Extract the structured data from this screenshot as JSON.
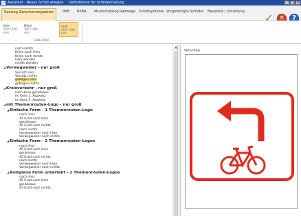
{
  "titlebar": {
    "app": "Assistent · Neues Schild anlegen",
    "subtitle": "Definitionen für Schilderstellung",
    "buttons": [
      "_",
      "□",
      "X"
    ]
  },
  "tabs": [
    {
      "label": "Radweg-Zwischenwegweiser",
      "active": true
    },
    {
      "label": "RhB"
    },
    {
      "label": "RhBA"
    },
    {
      "label": "Musterkatalog"
    },
    {
      "label": "Radwege"
    },
    {
      "label": "Schildsymbole"
    },
    {
      "label": "Vorgefertigte Schilder"
    },
    {
      "label": "Baustelle / Umleitung"
    }
  ],
  "actions": {
    "ok": "✓",
    "cancel": "✕",
    "help": "?"
  },
  "ribbon": {
    "sizes": [
      {
        "label": "Klein",
        "dims": "250 * 250 mm"
      },
      {
        "label": "Mittel",
        "dims": "300 * 300 mm"
      },
      {
        "label": "Groß",
        "dims": "350 * 350 mm",
        "selected": true
      }
    ],
    "group_label": "Größe Tafel"
  },
  "preview": {
    "label": "Vorschau"
  },
  "colors": {
    "sign_red": "#e02a1c",
    "highlight": "#f7dc62",
    "titlebar": "#1e4fa0",
    "ribbon_selected": "#fbdc96"
  },
  "tree": [
    {
      "text": "nach rechts",
      "level": 2
    },
    {
      "text": "Knick nach links",
      "level": 2
    },
    {
      "text": "Knick nach rechts",
      "level": 2
    },
    {
      "text": "links wenden",
      "level": 2
    },
    {
      "text": "rechts wenden",
      "level": 2
    },
    {
      "text": "Vorwegweiser - nur groß",
      "level": 0,
      "heading": true
    },
    {
      "text": "Versatz links",
      "level": 2
    },
    {
      "text": "Versatz rechts",
      "level": 2
    },
    {
      "text": "gebogen links",
      "level": 2,
      "highlight": true
    },
    {
      "text": "gebogen rechts",
      "level": 2
    },
    {
      "text": "Kreisverkehr - nur groß",
      "level": 0,
      "heading": true
    },
    {
      "text": "nach Kreis geradeaus",
      "level": 2
    },
    {
      "text": "im Kreis 1. Abzweig",
      "level": 2
    },
    {
      "text": "im Kreis 3. Abzweig",
      "level": 2
    },
    {
      "text": "mit Themenrouten-Logo - nur groß",
      "level": 0,
      "heading": true
    },
    {
      "text": "Einfache Form - 1 Themenrouten-Logo",
      "level": 1,
      "heading": true
    },
    {
      "text": "nach links",
      "level": 3
    },
    {
      "text": "45 Grad nach links",
      "level": 3
    },
    {
      "text": "geradeaus",
      "level": 3
    },
    {
      "text": "45 Grad nach rechts",
      "level": 3
    },
    {
      "text": "nach rechts",
      "level": 3
    },
    {
      "text": "Vorwegweiser nach links",
      "level": 3
    },
    {
      "text": "Vorwegweiser nach rechts",
      "level": 3
    },
    {
      "text": "Einfache Form - 2 Themenrouten-Logos",
      "level": 1,
      "heading": true
    },
    {
      "text": "nach links",
      "level": 3
    },
    {
      "text": "45 Grad nach links",
      "level": 3
    },
    {
      "text": "geradeaus",
      "level": 3
    },
    {
      "text": "45 Grad nach rechts",
      "level": 3
    },
    {
      "text": "nach rechts",
      "level": 3
    },
    {
      "text": "Vorwegweiser nach links",
      "level": 3
    },
    {
      "text": "Vorwegweiser nach rechts",
      "level": 3
    },
    {
      "text": "Komplexe Form unterteilt - 2 Themenrouten-Logos",
      "level": 1,
      "heading": true
    },
    {
      "text": "nach links",
      "level": 3
    },
    {
      "text": "45 Grad nach links",
      "level": 3
    },
    {
      "text": "geradeaus",
      "level": 3
    },
    {
      "text": "45 Grad nach rechts",
      "level": 3
    }
  ]
}
